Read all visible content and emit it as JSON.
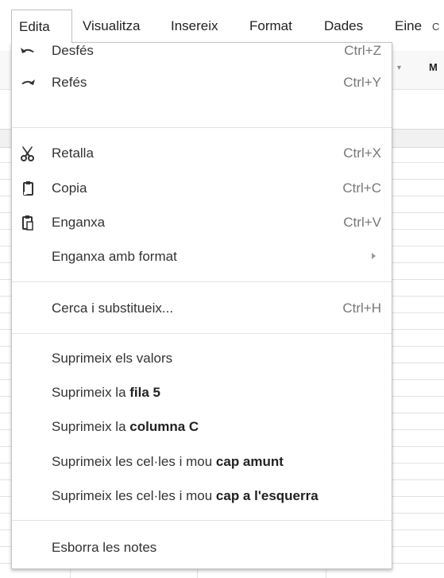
{
  "menubar": {
    "items": [
      {
        "label": "Edita",
        "active": true
      },
      {
        "label": "Visualitza"
      },
      {
        "label": "Insereix"
      },
      {
        "label": "Format"
      },
      {
        "label": "Dades"
      },
      {
        "label": "Eine"
      }
    ],
    "right_fragment": "C"
  },
  "toolbar": {
    "partial_label": "M"
  },
  "edit_menu": {
    "undo": {
      "label": "Desfés",
      "shortcut": "Ctrl+Z",
      "icon": "undo-icon"
    },
    "redo": {
      "label": "Refés",
      "shortcut": "Ctrl+Y",
      "icon": "redo-icon"
    },
    "cut": {
      "label": "Retalla",
      "shortcut": "Ctrl+X",
      "icon": "scissors-icon"
    },
    "copy": {
      "label": "Copia",
      "shortcut": "Ctrl+C",
      "icon": "copy-icon"
    },
    "paste": {
      "label": "Enganxa",
      "shortcut": "Ctrl+V",
      "icon": "paste-icon"
    },
    "paste_format": {
      "label": "Enganxa amb format"
    },
    "find_replace": {
      "label": "Cerca i substitueix...",
      "shortcut": "Ctrl+H"
    },
    "delete_values": {
      "label": "Suprimeix els valors"
    },
    "delete_row": {
      "prefix": "Suprimeix la ",
      "bold": "fila 5"
    },
    "delete_column": {
      "prefix": "Suprimeix la ",
      "bold": "columna C"
    },
    "delete_cells_up": {
      "prefix": "Suprimeix les cel·les i mou ",
      "bold": "cap amunt"
    },
    "delete_cells_left": {
      "prefix": "Suprimeix les cel·les i mou ",
      "bold": "cap a l'esquerra"
    },
    "clear_notes": {
      "label": "Esborra les notes"
    }
  },
  "colors": {
    "menu_text": "#333333",
    "shortcut_text": "#777777",
    "divider": "#e3e3e3",
    "menu_border": "#c4c4c4"
  }
}
